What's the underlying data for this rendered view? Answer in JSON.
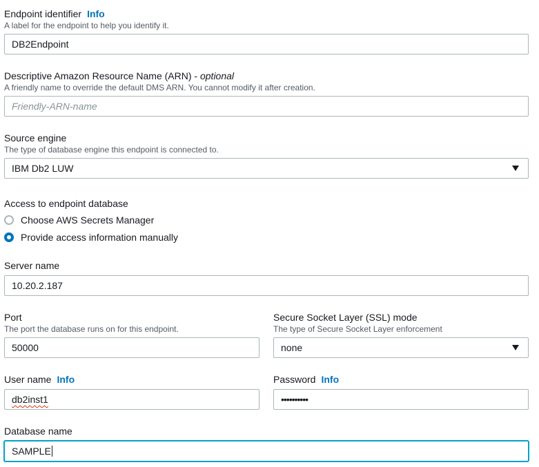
{
  "endpoint_identifier": {
    "label": "Endpoint identifier",
    "info": "Info",
    "description": "A label for the endpoint to help you identify it.",
    "value": "DB2Endpoint"
  },
  "arn": {
    "label": "Descriptive Amazon Resource Name (ARN)",
    "label_suffix": "optional",
    "description": "A friendly name to override the default DMS ARN. You cannot modify it after creation.",
    "placeholder": "Friendly-ARN-name"
  },
  "source_engine": {
    "label": "Source engine",
    "description": "The type of database engine this endpoint is connected to.",
    "value": "IBM Db2 LUW"
  },
  "access": {
    "label": "Access to endpoint database",
    "options": [
      {
        "label": "Choose AWS Secrets Manager",
        "checked": false
      },
      {
        "label": "Provide access information manually",
        "checked": true
      }
    ]
  },
  "server_name": {
    "label": "Server name",
    "value": "10.20.2.187"
  },
  "port": {
    "label": "Port",
    "description": "The port the database runs on for this endpoint.",
    "value": "50000"
  },
  "ssl_mode": {
    "label": "Secure Socket Layer (SSL) mode",
    "description": "The type of Secure Socket Layer enforcement",
    "value": "none"
  },
  "user_name": {
    "label": "User name",
    "info": "Info",
    "value": "db2inst1"
  },
  "password": {
    "label": "Password",
    "info": "Info",
    "value": "••••••••••"
  },
  "database_name": {
    "label": "Database name",
    "value": "SAMPLE"
  },
  "colors": {
    "accent": "#0073bb",
    "focus": "#00a1c9",
    "border": "#aab7b8",
    "description_text": "#545b64"
  }
}
